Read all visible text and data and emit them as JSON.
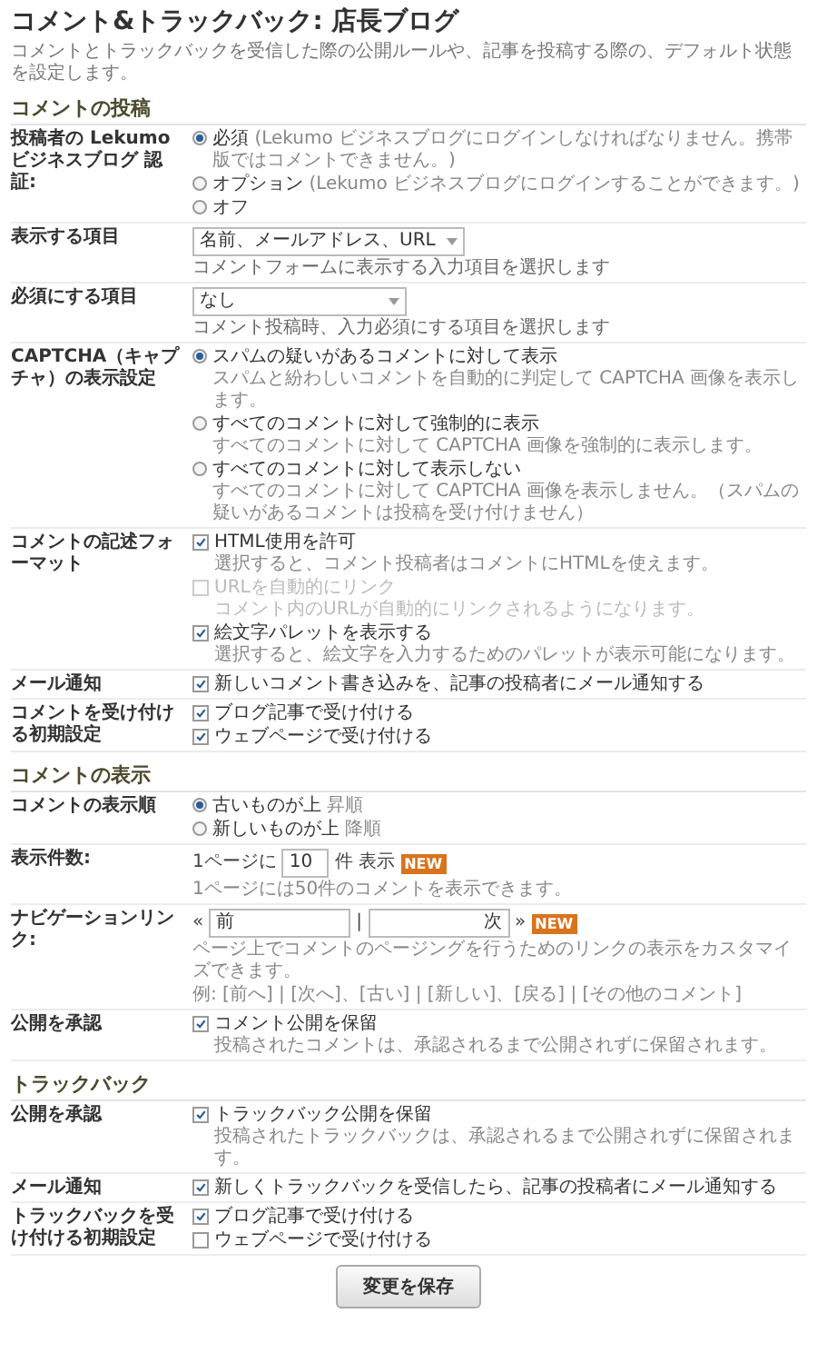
{
  "page": {
    "title": "コメント&トラックバック: 店長ブログ",
    "intro": "コメントとトラックバックを受信した際の公開ルールや、記事を投稿する際の、デフォルト状態を設定します。"
  },
  "sections": [
    {
      "heading": "コメントの投稿",
      "rows": [
        {
          "label": "投稿者の Lekumo ビジネスブログ 認証:",
          "controls": [
            {
              "kind": "radio",
              "label": "必須",
              "note": "(Lekumo ビジネスブログにログインしなければなりません。携帯版ではコメントできません。)",
              "selected": true
            },
            {
              "kind": "radio",
              "label": "オプション",
              "note": "(Lekumo ビジネスブログにログインすることができます。)",
              "selected": false
            },
            {
              "kind": "radio",
              "label": "オフ",
              "selected": false
            }
          ]
        },
        {
          "label": "表示する項目",
          "controls": [
            {
              "kind": "select",
              "value": "名前、メールアドレス、URL",
              "hint": "コメントフォームに表示する入力項目を選択します"
            }
          ]
        },
        {
          "label": "必須にする項目",
          "controls": [
            {
              "kind": "select",
              "value": "なし",
              "hint": "コメント投稿時、入力必須にする項目を選択します"
            }
          ]
        },
        {
          "label": "CAPTCHA（キャプチャ）の表示設定",
          "controls": [
            {
              "kind": "radio",
              "label": "スパムの疑いがあるコメントに対して表示",
              "desc": "スパムと紛わしいコメントを自動的に判定して CAPTCHA 画像を表示します。",
              "selected": true
            },
            {
              "kind": "radio",
              "label": "すべてのコメントに対して強制的に表示",
              "desc": "すべてのコメントに対して CAPTCHA 画像を強制的に表示します。",
              "selected": false
            },
            {
              "kind": "radio",
              "label": "すべてのコメントに対して表示しない",
              "desc": "すべてのコメントに対して CAPTCHA 画像を表示しません。（スパムの疑いがあるコメントは投稿を受け付けません）",
              "selected": false
            }
          ]
        },
        {
          "label": "コメントの記述フォーマット",
          "controls": [
            {
              "kind": "checkbox",
              "label": "HTML使用を許可",
              "desc": "選択すると、コメント投稿者はコメントにHTMLを使えます。",
              "checked": true,
              "disabled": false
            },
            {
              "kind": "checkbox",
              "label": "URLを自動的にリンク",
              "desc": "コメント内のURLが自動的にリンクされるようになります。",
              "checked": false,
              "disabled": true
            },
            {
              "kind": "checkbox",
              "label": "絵文字パレットを表示する",
              "desc": "選択すると、絵文字を入力するためのパレットが表示可能になります。",
              "checked": true,
              "disabled": false
            }
          ]
        },
        {
          "label": "メール通知",
          "controls": [
            {
              "kind": "checkbox",
              "label": "新しいコメント書き込みを、記事の投稿者にメール通知する",
              "checked": true,
              "disabled": false
            }
          ]
        },
        {
          "label": "コメントを受け付ける初期設定",
          "controls": [
            {
              "kind": "checkbox",
              "label": "ブログ記事で受け付ける",
              "checked": true,
              "disabled": false
            },
            {
              "kind": "checkbox",
              "label": "ウェブページで受け付ける",
              "checked": true,
              "disabled": false
            }
          ]
        }
      ]
    },
    {
      "heading": "コメントの表示",
      "rows": [
        {
          "label": "コメントの表示順",
          "controls": [
            {
              "kind": "radio",
              "label": "古いものが上",
              "note": "昇順",
              "selected": true
            },
            {
              "kind": "radio",
              "label": "新しいものが上",
              "note": "降順",
              "selected": false
            }
          ]
        },
        {
          "label": "表示件数:",
          "controls": [
            {
              "kind": "count",
              "prefix": "1ページに",
              "value": "10",
              "suffix": "件 表示",
              "badge": "NEW",
              "desc": "1ページには50件のコメントを表示できます。"
            }
          ]
        },
        {
          "label": "ナビゲーションリンク:",
          "controls": [
            {
              "kind": "nav",
              "open": "«",
              "prev": "前",
              "separator": "|",
              "next": "次",
              "close": "»",
              "badge": "NEW",
              "desc": "ページ上でコメントのページングを行うためのリンクの表示をカスタマイズできます。",
              "example": "例: [前へ] | [次へ]、[古い] | [新しい]、[戻る] | [その他のコメント]"
            }
          ]
        },
        {
          "label": "公開を承認",
          "controls": [
            {
              "kind": "checkbox",
              "label": "コメント公開を保留",
              "desc": "投稿されたコメントは、承認されるまで公開されずに保留されます。",
              "checked": true,
              "disabled": false
            }
          ]
        }
      ]
    },
    {
      "heading": "トラックバック",
      "rows": [
        {
          "label": "公開を承認",
          "controls": [
            {
              "kind": "checkbox",
              "label": "トラックバック公開を保留",
              "desc": "投稿されたトラックバックは、承認されるまで公開されずに保留されます。",
              "checked": true,
              "disabled": false
            }
          ]
        },
        {
          "label": "メール通知",
          "controls": [
            {
              "kind": "checkbox",
              "label": "新しくトラックバックを受信したら、記事の投稿者にメール通知する",
              "checked": true,
              "disabled": false
            }
          ]
        },
        {
          "label": "トラックバックを受け付ける初期設定",
          "controls": [
            {
              "kind": "checkbox",
              "label": "ブログ記事で受け付ける",
              "checked": true,
              "disabled": false
            },
            {
              "kind": "checkbox",
              "label": "ウェブページで受け付ける",
              "checked": false,
              "disabled": false
            }
          ]
        }
      ]
    }
  ],
  "save_button": "変更を保存"
}
